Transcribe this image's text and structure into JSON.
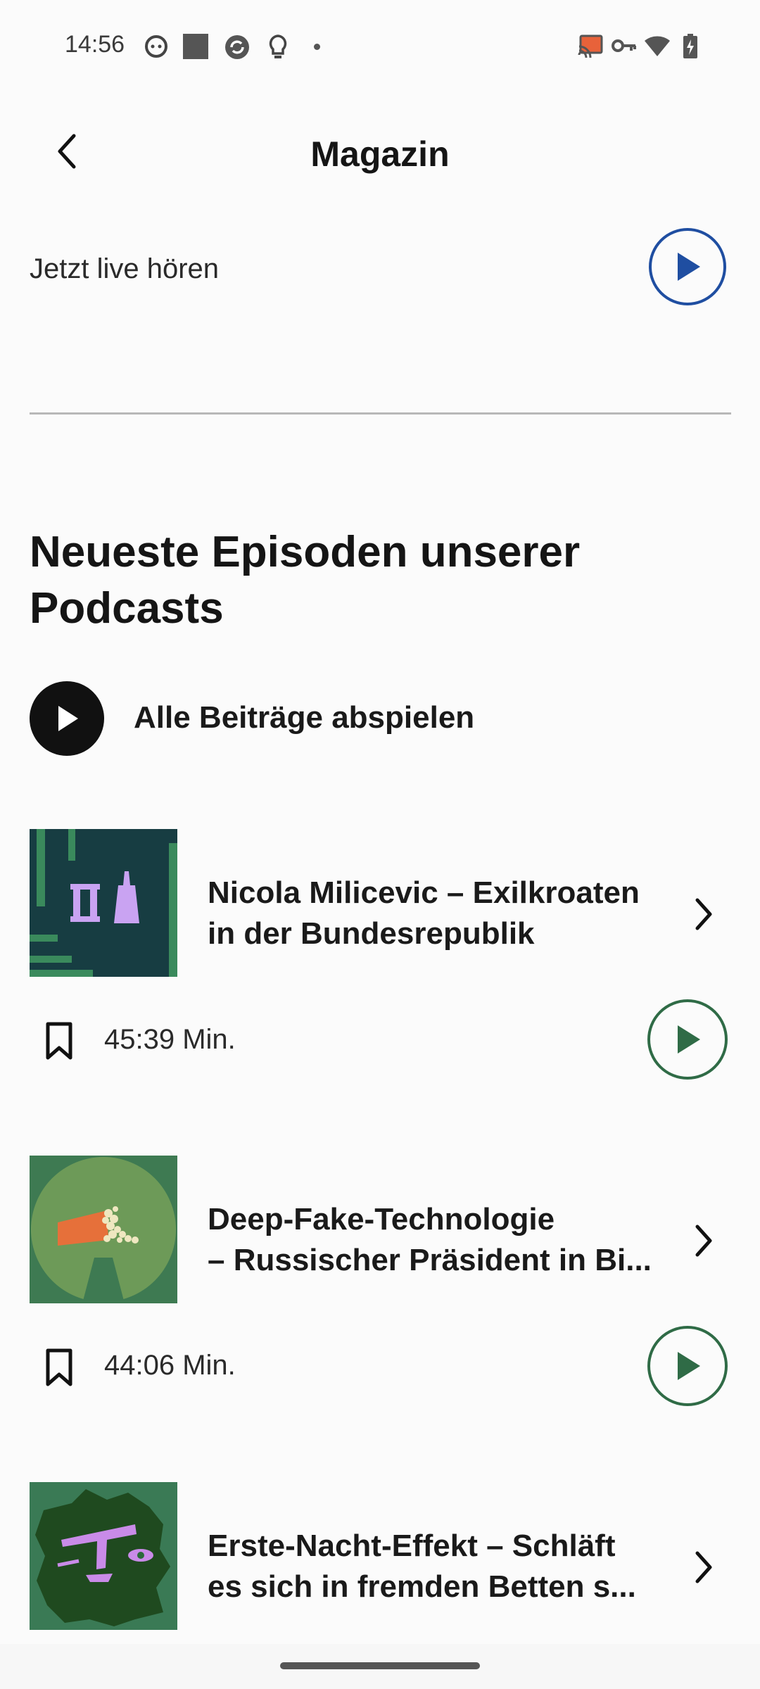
{
  "status_bar": {
    "time": "14:56",
    "left_icons": [
      "face-notification-icon",
      "square-notification-icon",
      "sync-notification-icon",
      "lightbulb-notification-icon",
      "more-dot-icon"
    ],
    "right_icons": [
      "cast-icon",
      "vpn-key-icon",
      "wifi-icon",
      "battery-charging-icon"
    ]
  },
  "header": {
    "title": "Magazin",
    "back_icon": "chevron-left-icon"
  },
  "live": {
    "label": "Jetzt live hören",
    "play_color": "#1f4ea1"
  },
  "section": {
    "title": "Neueste Episoden unserer Podcasts",
    "play_all_label": "Alle Beiträge abspielen"
  },
  "episodes": [
    {
      "title_line1": "Nicola Milicevic – Exilkroaten",
      "title_line2": "in der Bundesrepublik",
      "duration": "45:39 Min.",
      "thumb_bg": "#173d42",
      "play_color": "#2f6b46"
    },
    {
      "title_line1": "Deep-Fake-Technologie",
      "title_line2": "– Russischer Präsident in Bi...",
      "duration": "44:06 Min.",
      "thumb_bg": "#3e7a52",
      "play_color": "#2f6b46"
    },
    {
      "title_line1": "Erste-Nacht-Effekt – Schläft",
      "title_line2": "es sich in fremden Betten s...",
      "thumb_bg": "#3a7a55"
    }
  ]
}
